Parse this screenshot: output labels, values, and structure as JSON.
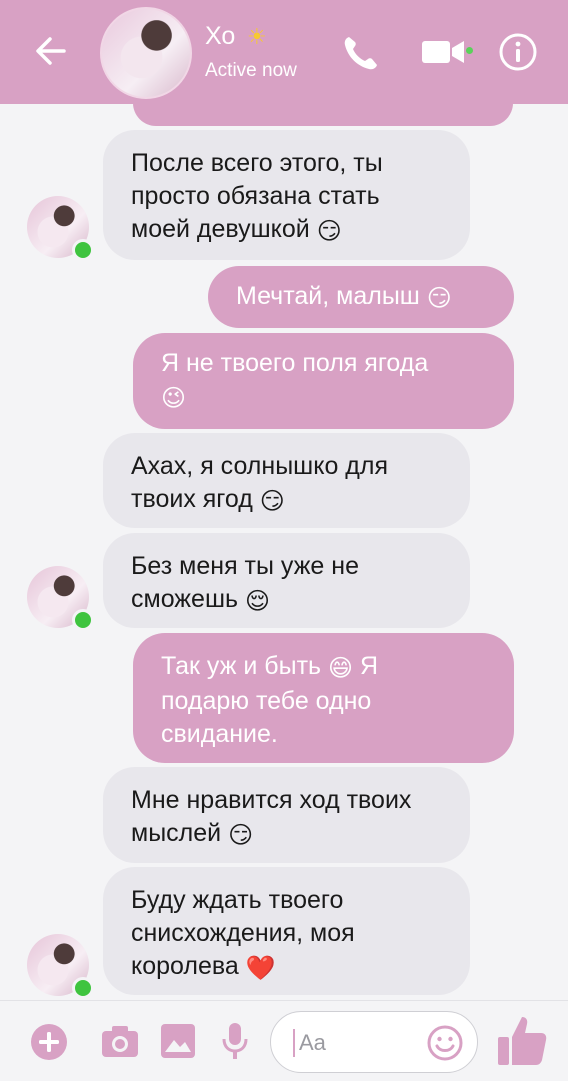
{
  "header": {
    "contact_name": "Хо",
    "contact_emoji": "☀",
    "status": "Active now"
  },
  "messages": [
    {
      "direction": "in",
      "text": "После всего этого, ты просто обязана стать моей девушкой",
      "emoji": "😏"
    },
    {
      "direction": "out",
      "text": "Мечтай, малыш",
      "emoji": "😏"
    },
    {
      "direction": "out",
      "text": "Я не твоего поля ягода",
      "emoji": "😉"
    },
    {
      "direction": "in",
      "text": "Ахах, я солнышко для твоих ягод",
      "emoji": "😏"
    },
    {
      "direction": "in",
      "text": "Без меня ты уже не сможешь",
      "emoji": "😌"
    },
    {
      "direction": "out",
      "text_before": "Так уж и быть",
      "emoji": "😄",
      "text_after": "Я подарю тебе одно свидание."
    },
    {
      "direction": "in",
      "text": "Мне нравится ход твоих мыслей",
      "emoji": "😏"
    },
    {
      "direction": "in",
      "text": "Буду ждать твоего снисхождения, моя королева",
      "emoji": "❤️"
    }
  ],
  "composer": {
    "placeholder": "Aa"
  },
  "colors": {
    "accent": "#d8a1c4",
    "incoming_bubble": "#e8e7ec",
    "online": "#3fc43f"
  },
  "icons": [
    "back-arrow-icon",
    "phone-icon",
    "video-camera-icon",
    "info-icon",
    "plus-icon",
    "camera-icon",
    "image-icon",
    "microphone-icon",
    "smiley-icon",
    "thumbs-up-icon"
  ]
}
